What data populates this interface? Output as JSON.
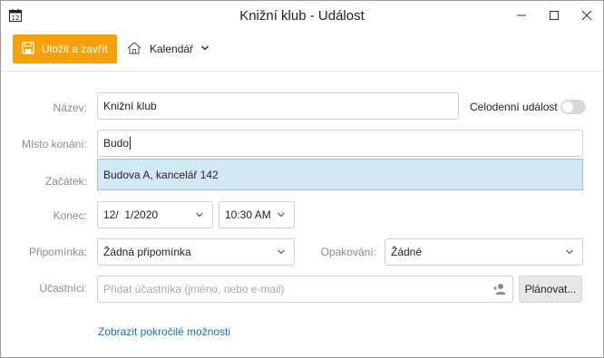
{
  "window": {
    "title": "Knižní klub - Událost",
    "app_icon_text": "12"
  },
  "toolbar": {
    "save_label": "Uložit a zavřít",
    "calendar_label": "Kalendář"
  },
  "form": {
    "name_label": "Název:",
    "name_value": "Knižní klub",
    "all_day_label": "Celodenní událost",
    "all_day_on": false,
    "location_label": "Místo konání:",
    "location_value": "Budo",
    "location_suggestion": "Budova A, kancelář 142",
    "start_label": "Začátek:",
    "end_label": "Konec:",
    "end_date": "12/  1/2020",
    "end_time": "10:30 AM",
    "reminder_label": "Připomínka:",
    "reminder_value": "Žádná připomínka",
    "repeat_label": "Opakování:",
    "repeat_value": "Žádné",
    "attendees_label": "Účastníci:",
    "attendees_placeholder": "Přidat účastníka (jméno, nebo e-mail)",
    "plan_button": "Plánovat...",
    "advanced_link": "Zobrazit pokročilé možnosti"
  },
  "colors": {
    "accent": "#f5a10b",
    "link": "#1a6fb4",
    "suggestion_bg": "#d4e7f5"
  }
}
